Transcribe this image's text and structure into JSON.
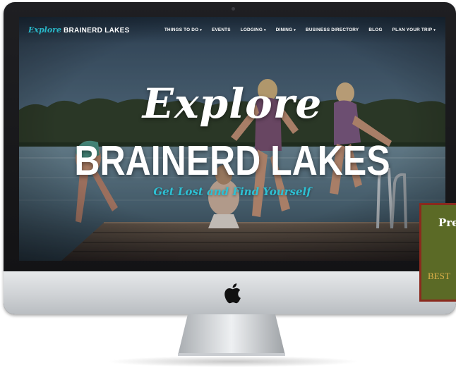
{
  "site": {
    "logo_script": "Explore",
    "logo_main": "BRAINERD LAKES"
  },
  "nav": {
    "items": [
      {
        "label": "THINGS TO DO",
        "has_dropdown": true
      },
      {
        "label": "EVENTS",
        "has_dropdown": false
      },
      {
        "label": "LODGING",
        "has_dropdown": true
      },
      {
        "label": "DINING",
        "has_dropdown": true
      },
      {
        "label": "BUSINESS DIRECTORY",
        "has_dropdown": false
      },
      {
        "label": "BLOG",
        "has_dropdown": false
      },
      {
        "label": "PLAN YOUR TRIP",
        "has_dropdown": true
      }
    ]
  },
  "hero": {
    "script_text": "Explore",
    "main_text": "BRAINERD LAKES",
    "tagline": "Get Lost and Find Yourself"
  },
  "promo": {
    "title": "Pre",
    "subtitle": "BEST"
  },
  "colors": {
    "accent_teal": "#2dc1d4",
    "promo_bg": "#5b6a26",
    "promo_border": "#8a2a1e",
    "promo_subtitle": "#e0b24a"
  },
  "icons": {
    "dropdown": "caret-down-icon",
    "device_logo": "apple-logo-icon"
  }
}
